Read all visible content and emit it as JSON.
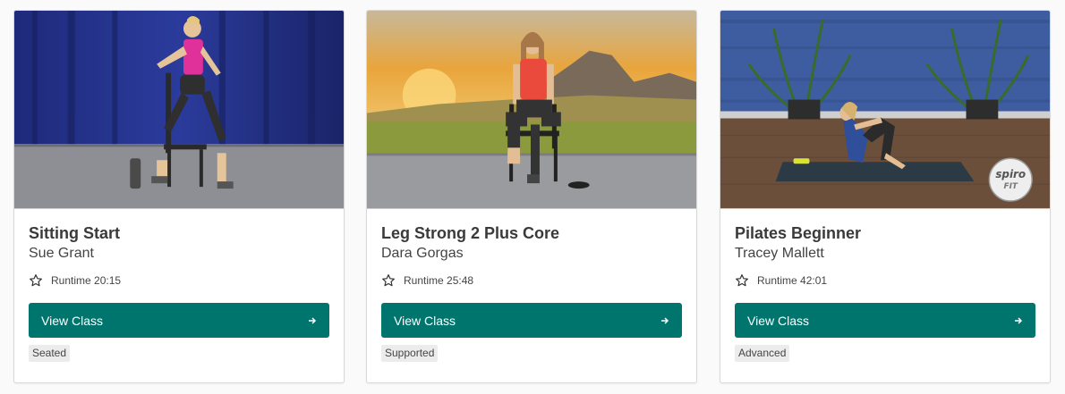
{
  "cards": [
    {
      "title": "Sitting Start",
      "instructor": "Sue Grant",
      "runtime": "Runtime 20:15",
      "button_label": "View Class",
      "tag": "Seated"
    },
    {
      "title": "Leg Strong 2 Plus Core",
      "instructor": "Dara Gorgas",
      "runtime": "Runtime 25:48",
      "button_label": "View Class",
      "tag": "Supported"
    },
    {
      "title": "Pilates Beginner",
      "instructor": "Tracey Mallett",
      "runtime": "Runtime 42:01",
      "button_label": "View Class",
      "tag": "Advanced",
      "logo_text": "spiro FIT"
    }
  ],
  "colors": {
    "button": "#00756d",
    "tag_bg": "#ececec"
  },
  "icons": {
    "favorite": "star-outline-icon",
    "button_arrow": "arrow-right-icon"
  }
}
